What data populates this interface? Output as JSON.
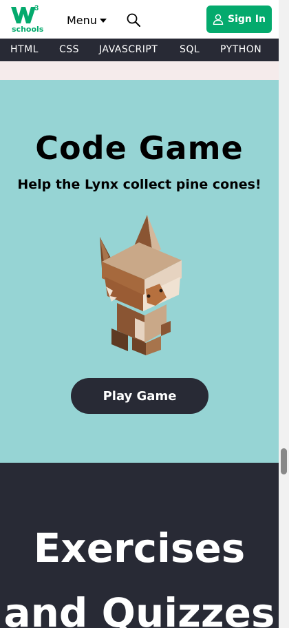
{
  "header": {
    "logo_sup": "3",
    "logo_text": "schools",
    "menu_label": "Menu",
    "signin_label": "Sign In"
  },
  "nav": {
    "items": [
      "HTML",
      "CSS",
      "JAVASCRIPT",
      "SQL",
      "PYTHON"
    ]
  },
  "game": {
    "title": "Code Game",
    "subtitle": "Help the Lynx collect pine cones!",
    "play_label": "Play Game"
  },
  "exercises": {
    "title_line1": "Exercises",
    "title_line2": "and Quizzes"
  },
  "colors": {
    "brand_green": "#04AA6D",
    "dark": "#282A35",
    "game_bg": "#96D4D4",
    "strip_bg": "#F5EBEB"
  },
  "icons": {
    "search": "search-icon",
    "user": "user-icon",
    "caret": "caret-down-icon",
    "logo": "w3schools-logo"
  }
}
